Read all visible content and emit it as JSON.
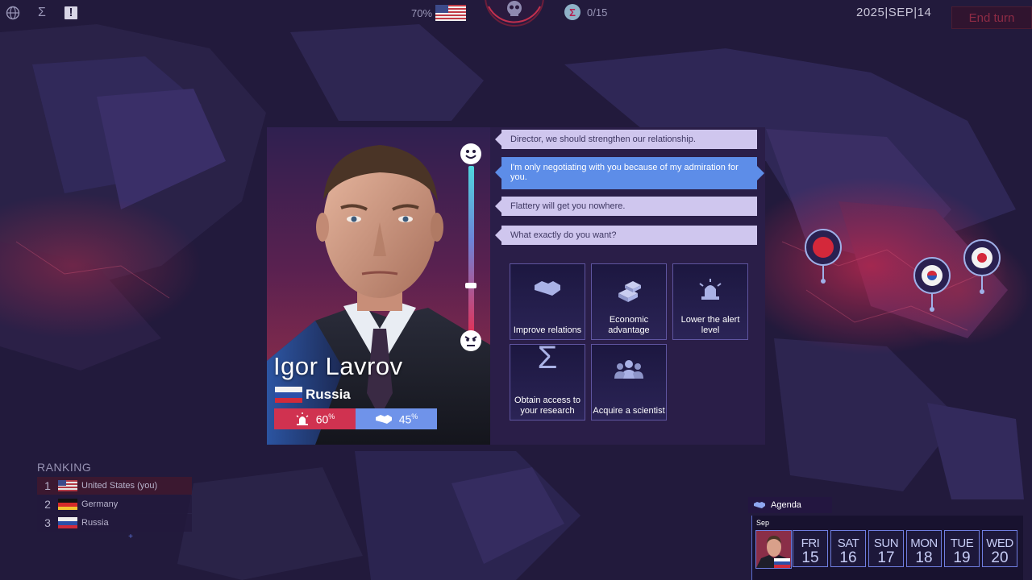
{
  "topbar": {
    "approval_pct": "70%",
    "research_count": "0/15",
    "date": "2025|SEP|14",
    "end_turn_label": "End turn",
    "alert_glyph": "!",
    "sigma_glyph": "Σ"
  },
  "character": {
    "name": "Igor Lavrov",
    "country": "Russia",
    "alert_level": "60",
    "relation_level": "45",
    "mood_value": 0.72
  },
  "dialogue": [
    {
      "text": "Director, we should strengthen our relationship.",
      "selected": false
    },
    {
      "text": "I'm only negotiating with you because of my admiration for you.",
      "selected": true
    },
    {
      "text": "Flattery will get you nowhere.",
      "selected": false
    },
    {
      "text": "What exactly do you want?",
      "selected": false
    }
  ],
  "actions": [
    {
      "label": "Improve relations",
      "icon": "handshake-icon"
    },
    {
      "label": "Economic advantage",
      "icon": "gold-bars-icon"
    },
    {
      "label": "Lower the alert level",
      "icon": "siren-icon"
    },
    {
      "label": "Obtain access to your research",
      "icon": "sigma-icon"
    },
    {
      "label": "Acquire a scientist",
      "icon": "group-icon"
    }
  ],
  "ranking": {
    "title": "RANKING",
    "rows": [
      {
        "rank": "1",
        "country": "United States (you)"
      },
      {
        "rank": "2",
        "country": "Germany"
      },
      {
        "rank": "3",
        "country": "Russia"
      }
    ]
  },
  "agenda": {
    "title": "Agenda",
    "month": "Sep",
    "days": [
      {
        "name": "FRI",
        "date": "15"
      },
      {
        "name": "SAT",
        "date": "16"
      },
      {
        "name": "SUN",
        "date": "17"
      },
      {
        "name": "MON",
        "date": "18"
      },
      {
        "name": "TUE",
        "date": "19"
      },
      {
        "name": "WED",
        "date": "20"
      }
    ]
  },
  "colors": {
    "alert": "#d03250",
    "relation": "#6f93ea",
    "selected_dialogue": "#5d8de8",
    "dialogue": "#cfc6ee"
  }
}
